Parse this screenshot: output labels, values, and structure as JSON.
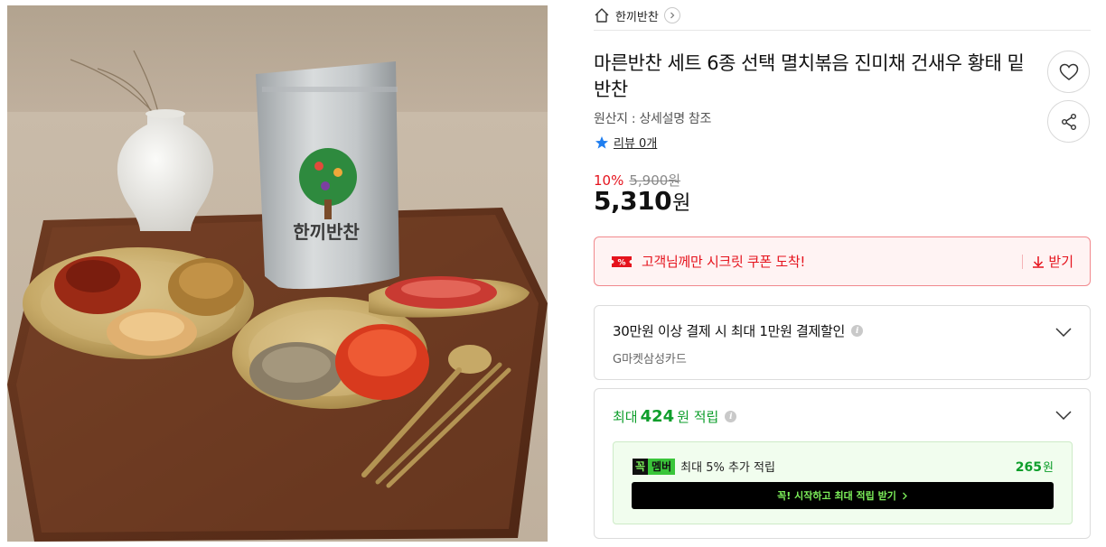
{
  "breadcrumb": {
    "shop": "한끼반찬"
  },
  "product": {
    "title": "마른반찬 세트 6종 선택 멸치볶음 진미채 건새우 황태 밑반찬",
    "origin": "원산지 : 상세설명 참조",
    "review_label": "리뷰 0개",
    "package_text": "한끼반찬"
  },
  "price": {
    "discount_rate": "10%",
    "original": "5,900원",
    "sale_amount": "5,310",
    "sale_unit": "원"
  },
  "coupon": {
    "text": "고객님께만 시크릿 쿠폰 도착!",
    "receive_label": "받기"
  },
  "card_discount": {
    "title": "30만원 이상 결제 시 최대 1만원 결제할인",
    "subtitle": "G마켓삼성카드"
  },
  "points": {
    "prefix": "최대",
    "amount": "424",
    "suffix": "원 적립",
    "member": {
      "badge_a": "꼭",
      "badge_b": "멤버",
      "text": "최대 5% 추가 적립",
      "amount": "265",
      "unit": "원",
      "cta": "꼭! 시작하고 최대 적립 받기"
    }
  },
  "colors": {
    "accent_red": "#e5131d",
    "accent_green": "#0e9e2b",
    "member_lime": "#7df05a",
    "review_star": "#1f7ef0"
  },
  "icons": [
    "home-icon",
    "chevron-right-icon",
    "heart-icon",
    "share-icon",
    "star-icon",
    "coupon-icon",
    "download-icon",
    "info-icon",
    "chevron-down-icon"
  ]
}
